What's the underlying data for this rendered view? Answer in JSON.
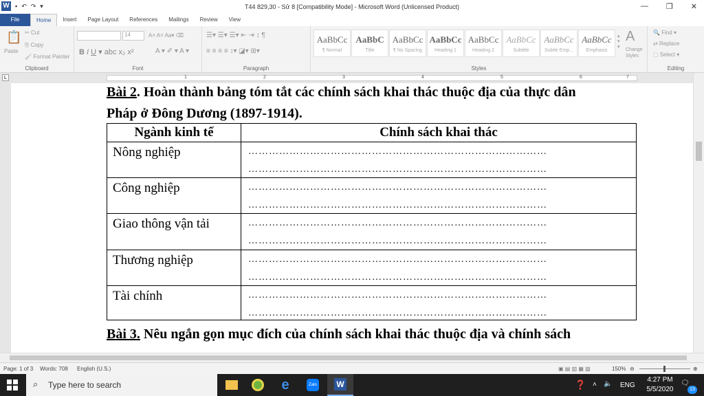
{
  "app": {
    "title": "T44 829,30 - Sử 8 [Compatibility Mode] - Microsoft Word (Unlicensed Product)"
  },
  "tabs": [
    "File",
    "Home",
    "Insert",
    "Page Layout",
    "References",
    "Mailings",
    "Review",
    "View"
  ],
  "ribbon": {
    "clipboard": {
      "paste": "Paste",
      "cut": "Cut",
      "copy": "Copy",
      "format_painter": "Format Painter",
      "label": "Clipboard"
    },
    "font": {
      "size": "14",
      "label": "Font"
    },
    "paragraph": {
      "label": "Paragraph"
    },
    "styles": {
      "label": "Styles",
      "items": [
        {
          "sample": "AaBbCc",
          "name": "¶ Normal"
        },
        {
          "sample": "AaBbC",
          "name": "Title"
        },
        {
          "sample": "AaBbCc",
          "name": "¶ No Spacing"
        },
        {
          "sample": "AaBbCc",
          "name": "Heading 1"
        },
        {
          "sample": "AaBbCc",
          "name": "Heading 2"
        },
        {
          "sample": "AaBbCc",
          "name": "Subtitle"
        },
        {
          "sample": "AaBbCc",
          "name": "Subtle Emp..."
        },
        {
          "sample": "AaBbCc",
          "name": "Emphasis"
        }
      ],
      "change_styles": "Change Styles"
    },
    "editing": {
      "find": "Find",
      "replace": "Replace",
      "select": "Select",
      "label": "Editing"
    }
  },
  "ruler": {
    "numbers": [
      "1",
      "2",
      "3",
      "4",
      "5",
      "6",
      "7"
    ]
  },
  "document": {
    "bai2_lead": "Bài 2",
    "bai2_rest": ". Hoàn thành bảng tóm tắt các chính sách khai thác thuộc địa của thực dân",
    "bai2_line2": "Pháp ở Đông Dương (1897-1914).",
    "table": {
      "headers": [
        "Ngành kinh tế",
        "Chính sách khai thác"
      ],
      "rows": [
        {
          "label": "Nông nghiệp"
        },
        {
          "label": "Công nghiệp"
        },
        {
          "label": "Giao thông vận tải"
        },
        {
          "label": "Thương nghiệp"
        },
        {
          "label": "Tài chính"
        }
      ],
      "dots": "……………………………………………………………………………"
    },
    "bai3_lead": "Bài 3.",
    "bai3_rest": " Nêu ngắn gọn mục đích của chính sách khai thác thuộc địa và chính sách"
  },
  "status": {
    "page": "Page: 1 of 3",
    "words": "Words: 708",
    "language": "English (U.S.)",
    "zoom": "150%"
  },
  "taskbar": {
    "search_placeholder": "Type here to search",
    "time": "4:27 PM",
    "date": "5/5/2020",
    "lang": "ENG",
    "notifications": "13"
  },
  "colors": {
    "word_blue": "#2b579a",
    "taskbar": "#1f1f1f"
  }
}
